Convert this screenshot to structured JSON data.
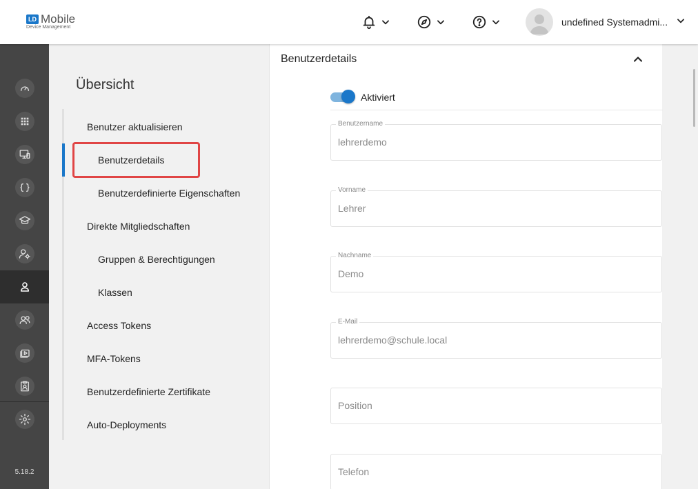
{
  "header": {
    "logo_mark": "LD",
    "logo_title": "Mobile",
    "logo_subtitle": "Device Management",
    "notifications_icon": "bell-icon",
    "compass_icon": "compass-icon",
    "help_icon": "help-icon",
    "user_name": "undefined Systemadmi...",
    "accent": "#1a77c9"
  },
  "rail": {
    "items": [
      {
        "icon": "dashboard-icon"
      },
      {
        "icon": "apps-grid-icon"
      },
      {
        "icon": "devices-icon"
      },
      {
        "icon": "braces-icon"
      },
      {
        "icon": "school-icon"
      },
      {
        "icon": "user-settings-icon"
      },
      {
        "icon": "user-icon",
        "active": true
      },
      {
        "icon": "users-icon"
      },
      {
        "icon": "media-library-icon"
      },
      {
        "icon": "id-badge-icon"
      },
      {
        "icon": "gear-icon"
      }
    ],
    "version": "5.18.2"
  },
  "nav": {
    "title": "Übersicht",
    "items": [
      "Benutzer aktualisieren",
      "Benutzerdetails",
      "Benutzerdefinierte Eigenschaften",
      "Direkte Mitgliedschaften",
      "Gruppen & Berechtigungen",
      "Klassen",
      "Access Tokens",
      "MFA-Tokens",
      "Benutzerdefinierte Zertifikate",
      "Auto-Deployments"
    ],
    "active_index": 1
  },
  "card": {
    "title": "Benutzerdetails",
    "toggle_label": "Aktiviert",
    "toggle_on": true,
    "fields": [
      {
        "label": "Benutzername",
        "value": "lehrerdemo"
      },
      {
        "label": "Vorname",
        "value": "Lehrer"
      },
      {
        "label": "Nachname",
        "value": "Demo"
      },
      {
        "label": "E-Mail",
        "value": "lehrerdemo@schule.local"
      },
      {
        "label": "",
        "placeholder": "Position"
      },
      {
        "label": "",
        "placeholder": "Telefon"
      }
    ]
  }
}
